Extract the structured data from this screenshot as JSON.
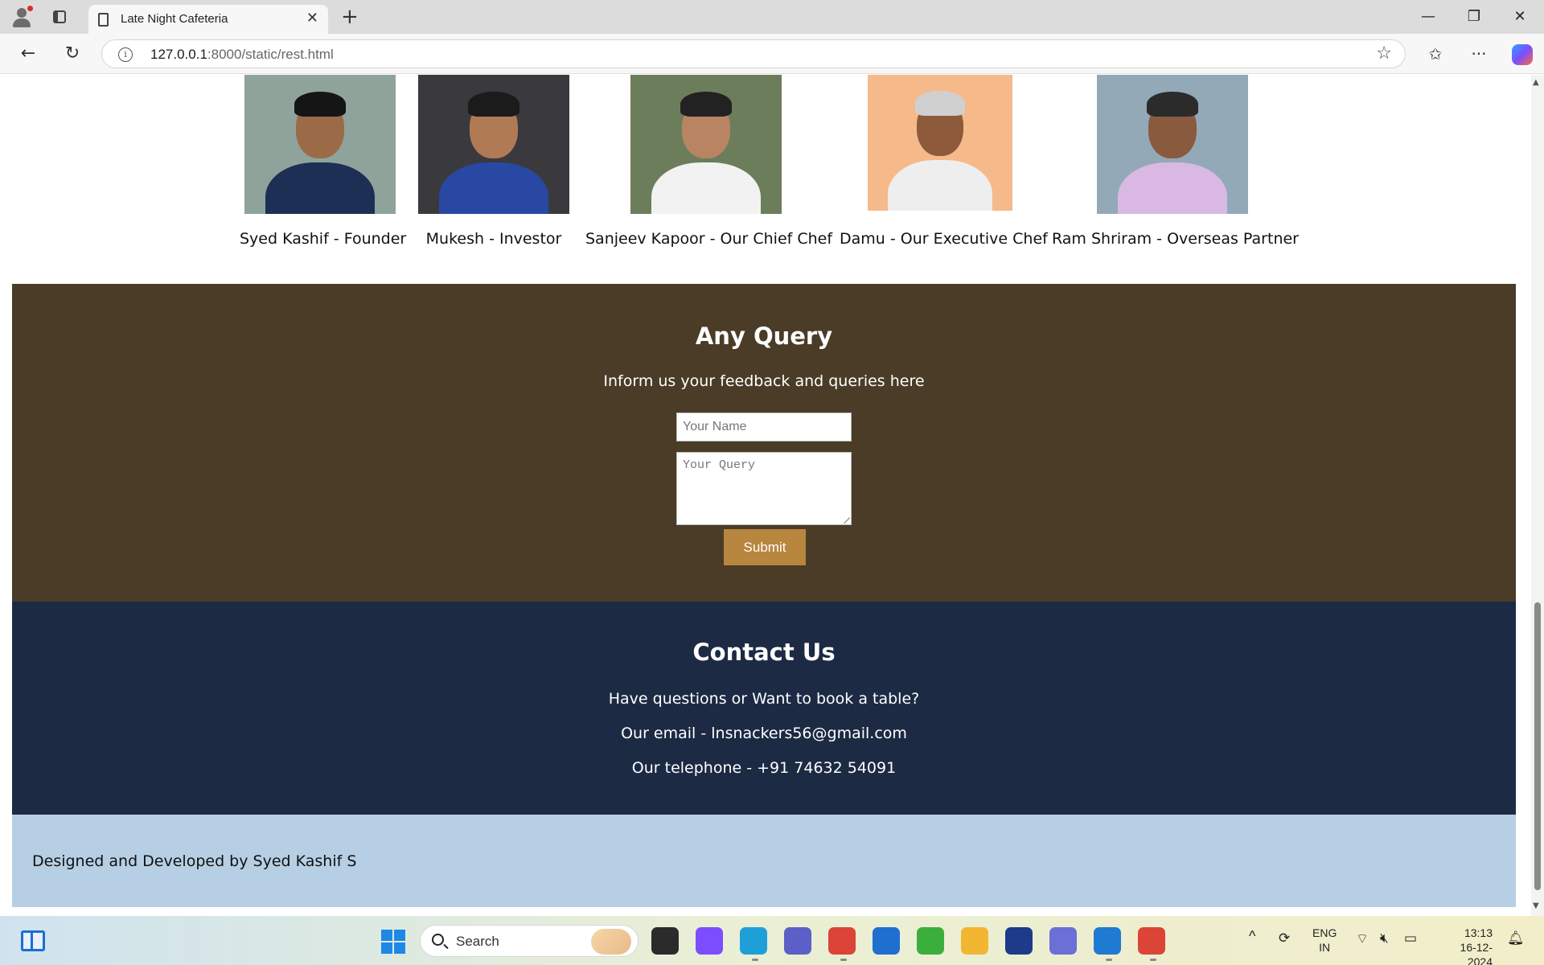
{
  "browser": {
    "tab_title": "Late Night Cafeteria",
    "tab_close": "✕",
    "new_tab": "+",
    "url_host": "127.0.0.1",
    "url_rest": ":8000/static/rest.html",
    "window": {
      "minimize": "—",
      "restore": "❐",
      "close": "✕"
    },
    "nav": {
      "back": "←",
      "reload": "↻"
    },
    "icons": {
      "star": "☆",
      "favorites": "✩",
      "more": "···",
      "info": "i"
    }
  },
  "team": {
    "members": [
      {
        "name": "Syed Kashif - Founder",
        "photo": {
          "bg": "#8fa39a",
          "shirt": "#1e2f55",
          "face": "#9b6b48",
          "hair": "#151515"
        }
      },
      {
        "name": "Mukesh - Investor",
        "photo": {
          "bg": "#3a3a3e",
          "shirt": "#2948a3",
          "face": "#b07a55",
          "hair": "#1b1b1b"
        }
      },
      {
        "name": "Sanjeev Kapoor - Our Chief Chef",
        "photo": {
          "bg": "#6c7d5b",
          "shirt": "#f2f2f2",
          "face": "#b98462",
          "hair": "#222222"
        }
      },
      {
        "name": "Damu - Our Executive Chef",
        "photo": {
          "bg": "#f6b98a",
          "shirt": "#eeeeee",
          "face": "#8e5a3c",
          "hair": "#d0d0d0"
        }
      },
      {
        "name": "Ram Shriram - Overseas Partner",
        "photo": {
          "bg": "#93a9b8",
          "shirt": "#d9b9e3",
          "face": "#8a5a3e",
          "hair": "#2b2b2b"
        }
      }
    ]
  },
  "query": {
    "title": "Any Query",
    "subtitle": "Inform us your feedback and queries here",
    "name_placeholder": "Your Name",
    "query_placeholder": "Your Query",
    "submit_label": "Submit"
  },
  "contact": {
    "title": "Contact Us",
    "lines": [
      "Have questions or Want to book a table?",
      "Our email - lnsnackers56@gmail.com",
      "Our telephone - +91 74632 54091"
    ]
  },
  "footer": {
    "credit": "Designed and Developed by Syed Kashif S"
  },
  "taskbar": {
    "search_label": "Search",
    "language": "ENG",
    "region": "IN",
    "time": "13:13",
    "date": "16-12-2024",
    "tray_chevron": "^",
    "apps": [
      {
        "name": "file-explorer-icon",
        "color": "#2b2b2b"
      },
      {
        "name": "copilot-icon",
        "color": "#7b4dff"
      },
      {
        "name": "edge-icon",
        "color": "#1f9fd8"
      },
      {
        "name": "teams-icon",
        "color": "#5b5fc7"
      },
      {
        "name": "chrome-icon",
        "color": "#db4437"
      },
      {
        "name": "store-icon",
        "color": "#1f6fd1"
      },
      {
        "name": "ring-icon",
        "color": "#3cae3c"
      },
      {
        "name": "folder-icon",
        "color": "#f2b632"
      },
      {
        "name": "l-app-icon",
        "color": "#1e3a8a"
      },
      {
        "name": "delta-icon",
        "color": "#6b6fd6"
      },
      {
        "name": "vscode-icon",
        "color": "#1f7ad1"
      },
      {
        "name": "chrome-2-icon",
        "color": "#db4437"
      }
    ]
  }
}
